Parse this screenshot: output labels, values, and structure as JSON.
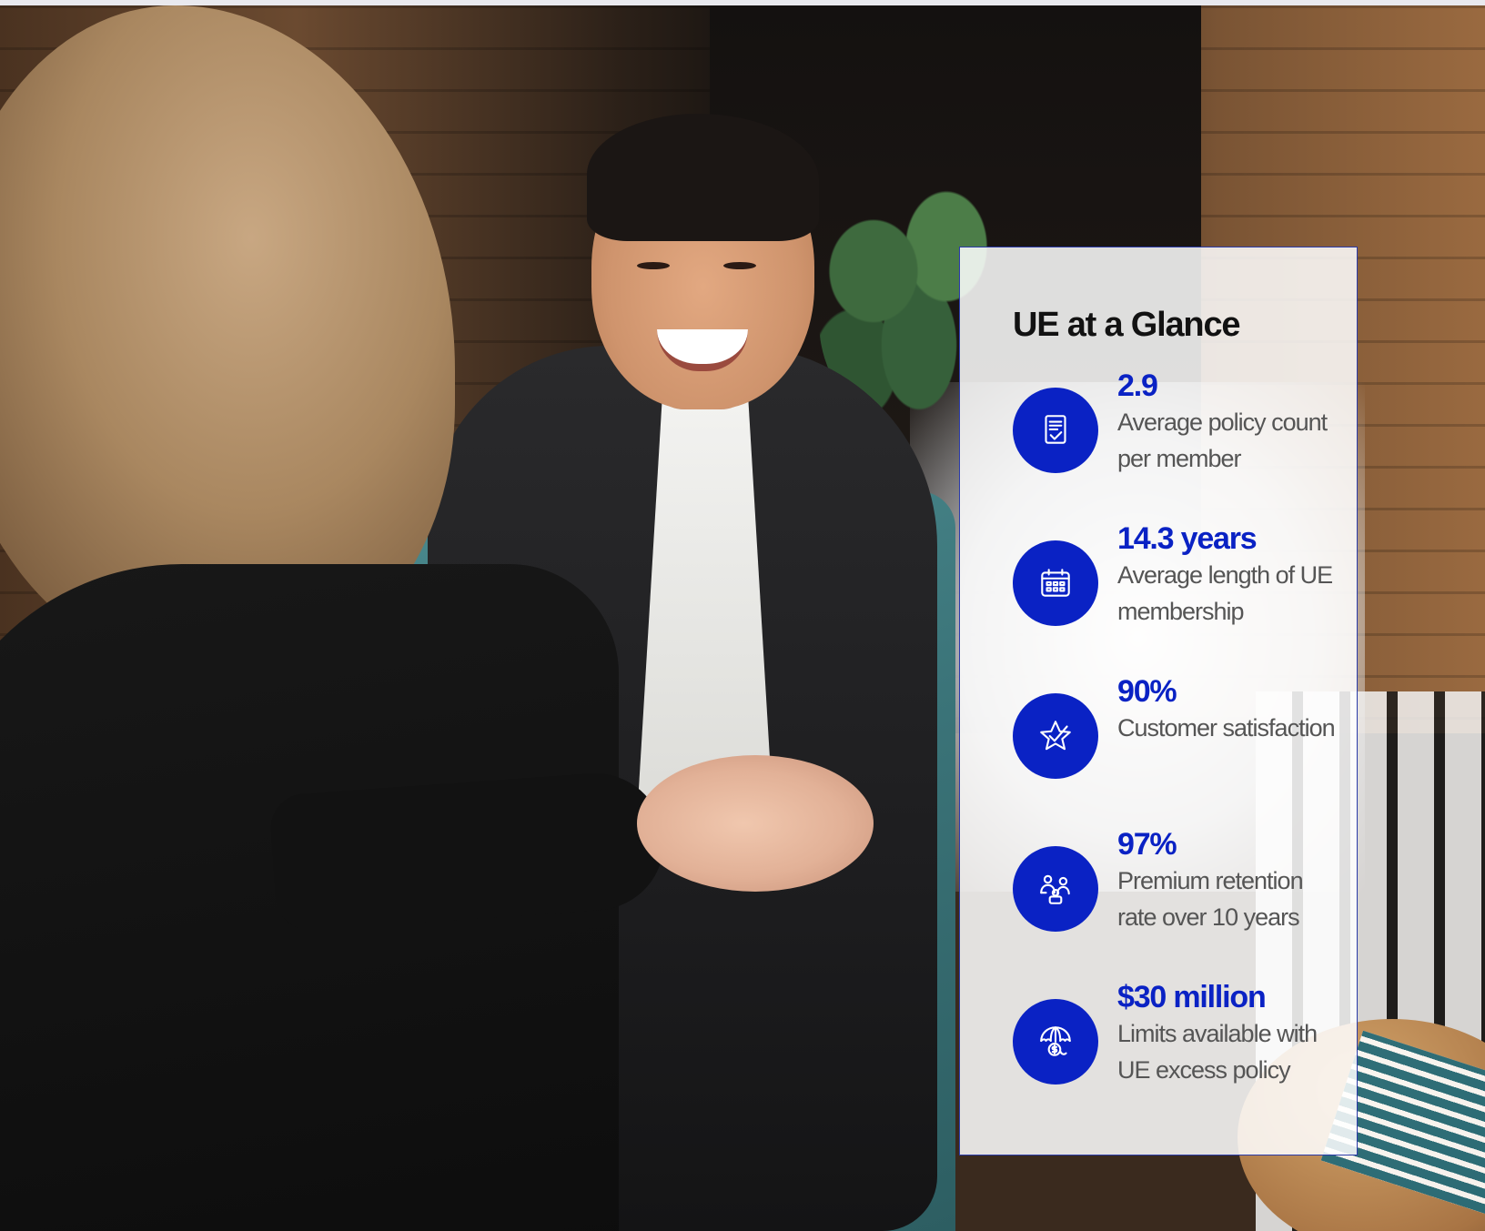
{
  "card": {
    "title": "UE at a Glance",
    "accent_color": "#0a22c4",
    "stats": [
      {
        "icon": "policy-document-check-icon",
        "value": "2.9",
        "label": "Average policy count per member"
      },
      {
        "icon": "calendar-icon",
        "value": "14.3 years",
        "label": "Average length of UE membership"
      },
      {
        "icon": "star-check-icon",
        "value": "90%",
        "label": "Customer satisfaction"
      },
      {
        "icon": "family-group-icon",
        "value": "97%",
        "label": "Premium retention rate over 10 years"
      },
      {
        "icon": "umbrella-dollar-icon",
        "value": "$30 million",
        "label": "Limits available with UE excess policy"
      }
    ]
  }
}
